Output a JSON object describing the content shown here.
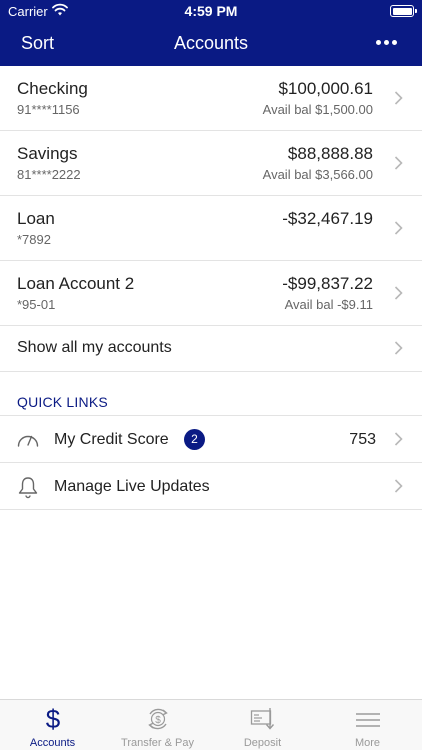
{
  "status_bar": {
    "carrier": "Carrier",
    "time": "4:59 PM"
  },
  "header": {
    "sort_label": "Sort",
    "title": "Accounts",
    "more_icon": "more-dots-icon"
  },
  "accounts": [
    {
      "name": "Checking",
      "number": "91****1156",
      "balance": "$100,000.61",
      "available": "Avail bal $1,500.00"
    },
    {
      "name": "Savings",
      "number": "81****2222",
      "balance": "$88,888.88",
      "available": "Avail bal $3,566.00"
    },
    {
      "name": "Loan",
      "number": "*7892",
      "balance": "-$32,467.19",
      "available": ""
    },
    {
      "name": "Loan Account 2",
      "number": "*95-01",
      "balance": "-$99,837.22",
      "available": "Avail bal -$9.11"
    }
  ],
  "show_all_label": "Show all my accounts",
  "quick_links": {
    "heading": "QUICK LINKS",
    "items": [
      {
        "label": "My Credit Score",
        "badge": "2",
        "value": "753",
        "icon": "gauge-icon"
      },
      {
        "label": "Manage Live Updates",
        "icon": "bell-icon"
      }
    ]
  },
  "tabs": [
    {
      "label": "Accounts",
      "icon": "dollar-icon",
      "active": true
    },
    {
      "label": "Transfer & Pay",
      "icon": "transfer-icon",
      "active": false
    },
    {
      "label": "Deposit",
      "icon": "deposit-check-icon",
      "active": false
    },
    {
      "label": "More",
      "icon": "menu-icon",
      "active": false
    }
  ],
  "colors": {
    "brand": "#0a1a84",
    "separator": "#e3e3e3",
    "inactive_tab": "#9a9a9a"
  }
}
